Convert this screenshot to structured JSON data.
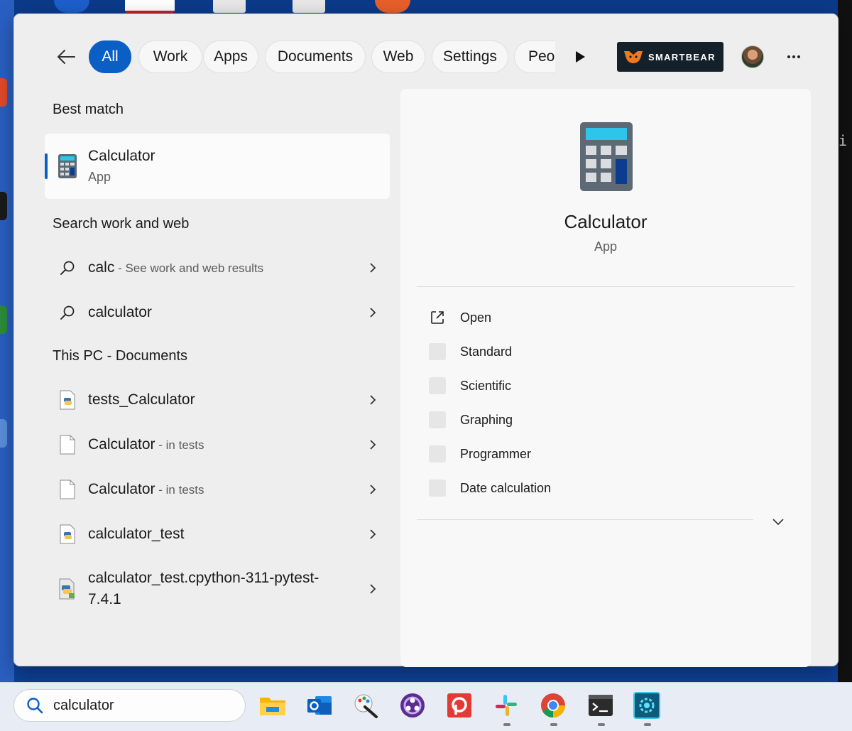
{
  "filters": {
    "back_label": "Back",
    "tabs": [
      "All",
      "Work",
      "Apps",
      "Documents",
      "Web",
      "Settings",
      "Peo"
    ],
    "active": "All",
    "org_logo_text": "SMARTBEAR",
    "more_label": "···"
  },
  "best_match": {
    "heading": "Best match",
    "title": "Calculator",
    "subtitle": "App"
  },
  "work_web": {
    "heading": "Search work and web",
    "items": [
      {
        "text": "calc",
        "sub": " - See work and web results"
      },
      {
        "text": "calculator",
        "sub": ""
      }
    ]
  },
  "documents": {
    "heading": "This PC - Documents",
    "items": [
      {
        "text": "tests_Calculator",
        "sub": "",
        "icon": "python-file-icon"
      },
      {
        "text": "Calculator",
        "sub": " - in tests",
        "icon": "blank-file-icon"
      },
      {
        "text": "Calculator",
        "sub": " - in tests",
        "icon": "blank-file-icon"
      },
      {
        "text": "calculator_test",
        "sub": "",
        "icon": "python-file-icon"
      },
      {
        "text": "calculator_test.cpython-311-pytest-7.4.1",
        "sub": "",
        "icon": "python-compiled-icon"
      }
    ]
  },
  "preview": {
    "title": "Calculator",
    "subtitle": "App",
    "actions": [
      "Open",
      "Standard",
      "Scientific",
      "Graphing",
      "Programmer",
      "Date calculation"
    ]
  },
  "taskbar": {
    "search_value": "calculator",
    "apps": [
      "file-explorer-icon",
      "outlook-icon",
      "paint-icon",
      "obs-icon",
      "pocket-casts-icon",
      "slack-icon",
      "chrome-icon",
      "terminal-icon",
      "settings-icon"
    ]
  },
  "colors": {
    "accent": "#0a5fc4",
    "panel": "#f8f8f8",
    "menu_bg": "#eeeeee",
    "smartbear": "#14212b"
  }
}
